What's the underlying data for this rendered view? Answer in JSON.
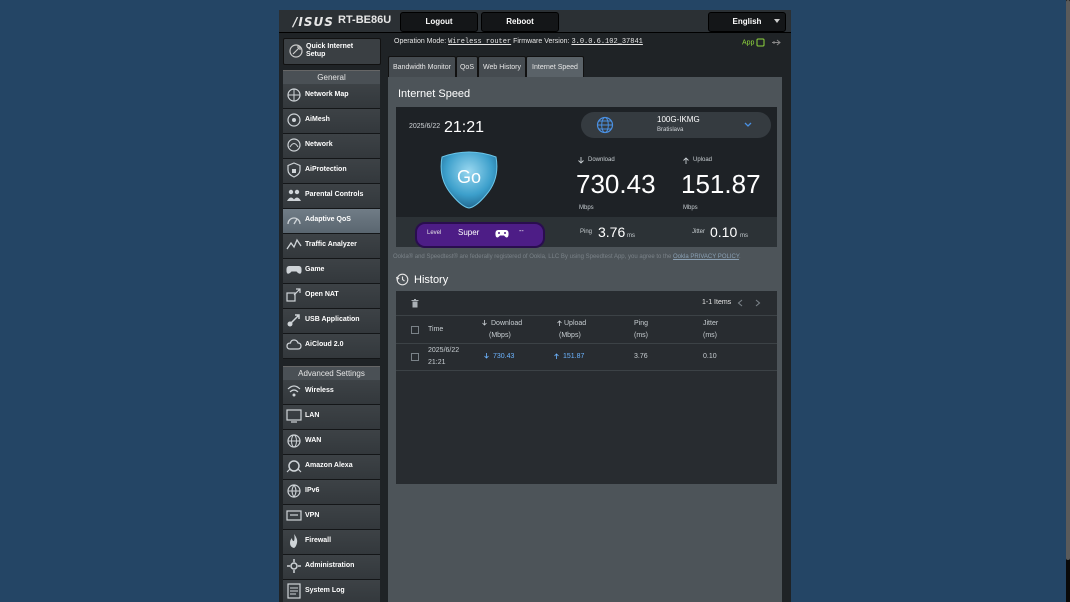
{
  "header": {
    "logo": "/ISUS",
    "model": "RT-BE86U",
    "logout_label": "Logout",
    "reboot_label": "Reboot",
    "language": "English"
  },
  "sidebar": {
    "quick_setup_line1": "Quick Internet",
    "quick_setup_line2": "Setup",
    "general_title": "General",
    "general_items": [
      {
        "label": "Network Map",
        "icon": "network-map-icon"
      },
      {
        "label": "AiMesh",
        "icon": "aimesh-icon"
      },
      {
        "label": "Network",
        "icon": "network-icon"
      },
      {
        "label": "AiProtection",
        "icon": "aiprotection-icon"
      },
      {
        "label": "Parental Controls",
        "icon": "parental-controls-icon"
      },
      {
        "label": "Adaptive QoS",
        "icon": "adaptive-qos-icon",
        "active": true
      },
      {
        "label": "Traffic Analyzer",
        "icon": "traffic-analyzer-icon"
      },
      {
        "label": "Game",
        "icon": "game-icon"
      },
      {
        "label": "Open NAT",
        "icon": "open-nat-icon"
      },
      {
        "label": "USB Application",
        "icon": "usb-application-icon"
      },
      {
        "label": "AiCloud 2.0",
        "icon": "aicloud-icon"
      }
    ],
    "advanced_title": "Advanced Settings",
    "advanced_items": [
      {
        "label": "Wireless",
        "icon": "wireless-icon"
      },
      {
        "label": "LAN",
        "icon": "lan-icon"
      },
      {
        "label": "WAN",
        "icon": "wan-icon"
      },
      {
        "label": "Amazon Alexa",
        "icon": "alexa-icon"
      },
      {
        "label": "IPv6",
        "icon": "ipv6-icon"
      },
      {
        "label": "VPN",
        "icon": "vpn-icon"
      },
      {
        "label": "Firewall",
        "icon": "firewall-icon"
      },
      {
        "label": "Administration",
        "icon": "administration-icon"
      },
      {
        "label": "System Log",
        "icon": "system-log-icon"
      }
    ]
  },
  "status": {
    "op_mode_label": "Operation Mode:",
    "op_mode_value": "Wireless router",
    "firmware_label": "Firmware Version:",
    "firmware_value": "3.0.0.6.102_37841",
    "app_label": "App"
  },
  "tabs": [
    {
      "label": "Bandwidth Monitor"
    },
    {
      "label": "QoS"
    },
    {
      "label": "Web History"
    },
    {
      "label": "Internet Speed",
      "active": true
    }
  ],
  "speed": {
    "title": "Internet Speed",
    "date": "2025/6/22",
    "time": "21:21",
    "server_name": "100G-IKMG",
    "server_city": "Bratislava",
    "go_label": "Go",
    "download_label": "Download",
    "download_value": "730.43",
    "download_unit": "Mbps",
    "upload_label": "Upload",
    "upload_value": "151.87",
    "upload_unit": "Mbps",
    "level_label": "Level",
    "level_value": "Super",
    "level_extra": "--",
    "ping_label": "Ping",
    "ping_value": "3.76",
    "ping_unit": "ms",
    "jitter_label": "Jitter",
    "jitter_value": "0.10",
    "jitter_unit": "ms",
    "footer_text": "Ookla® and Speedtest® are federally registered of Ookla, LLC By using Speedtest App, you agree to the",
    "footer_link": "Ookla PRIVACY POLICY",
    "footer_tail": "."
  },
  "history": {
    "title": "History",
    "items_count": "1-1 Items",
    "columns": {
      "time": "Time",
      "download": "Download",
      "download_unit": "(Mbps)",
      "upload": "Upload",
      "upload_unit": "(Mbps)",
      "ping": "Ping",
      "ping_unit": "(ms)",
      "jitter": "Jitter",
      "jitter_unit": "(ms)"
    },
    "rows": [
      {
        "date": "2025/6/22",
        "time": "21:21",
        "download": "730.43",
        "upload": "151.87",
        "ping": "3.76",
        "jitter": "0.10"
      }
    ]
  },
  "colors": {
    "accent_green": "#8fd53d",
    "level_purple": "#4d1d86",
    "link_blue": "#6cb4ff"
  }
}
